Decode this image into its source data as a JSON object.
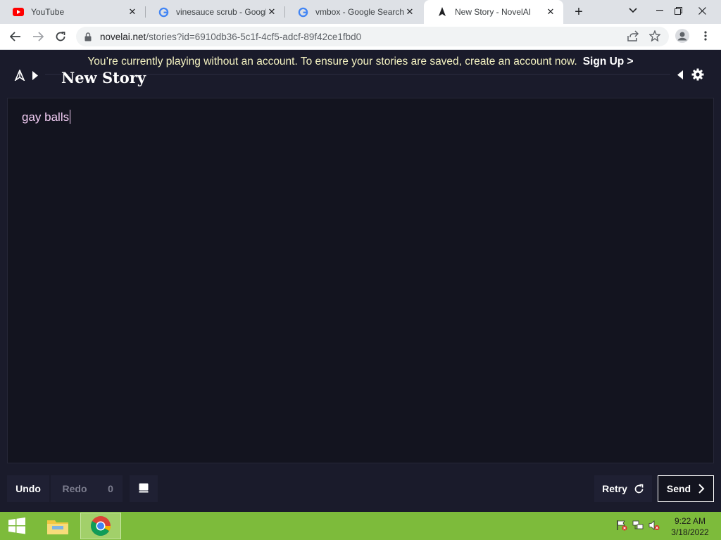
{
  "browser": {
    "tabs": [
      {
        "title": "YouTube",
        "icon": "youtube-icon"
      },
      {
        "title": "vinesauce scrub - Google Search",
        "icon": "google-icon"
      },
      {
        "title": "vmbox - Google Search",
        "icon": "google-icon"
      },
      {
        "title": "New Story - NovelAI",
        "icon": "novelai-icon",
        "active": true
      }
    ],
    "url_host": "novelai.net",
    "url_path": "/stories?id=6910db36-5c1f-4cf5-adcf-89f42ce1fbd0"
  },
  "app": {
    "banner_text": "You’re currently playing without an account. To ensure your stories are saved, create an account now.",
    "signup_label": "Sign Up >",
    "story_title": "New Story",
    "story_text": "gay balls",
    "undo_label": "Undo",
    "redo_label": "Redo",
    "redo_count": "0",
    "retry_label": "Retry",
    "send_label": "Send"
  },
  "taskbar": {
    "time": "9:22 AM",
    "date": "3/18/2022"
  },
  "colors": {
    "app_background": "#1a1b2b",
    "editor_background": "#13141f",
    "story_text": "#f2cdf4",
    "banner_text": "#f5f3c2",
    "taskbar": "#7dbb3b"
  }
}
